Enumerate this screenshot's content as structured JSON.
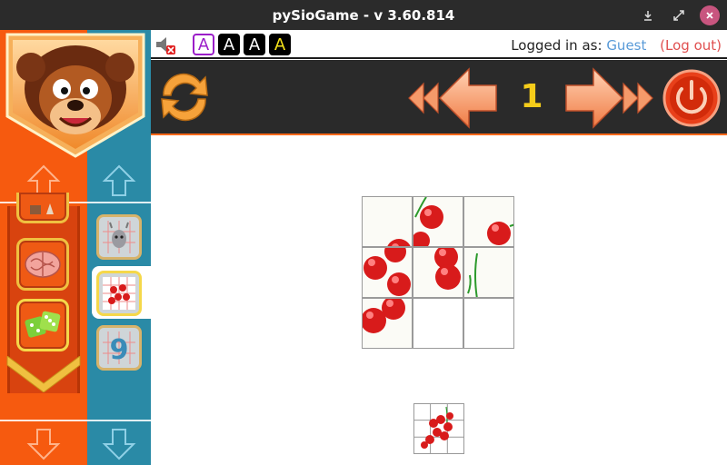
{
  "window": {
    "title": "pySioGame - v 3.60.814",
    "buttons": [
      "minimize",
      "maximize",
      "close"
    ]
  },
  "topbar": {
    "mute_icon": "speaker-muted-icon",
    "font_buttons": [
      {
        "label": "A",
        "bg": "#ffffff",
        "fg": "#9b1ec9",
        "border": "#9b1ec9"
      },
      {
        "label": "A",
        "bg": "#000000",
        "fg": "#ffffff",
        "border": "#000000"
      },
      {
        "label": "A",
        "bg": "#000000",
        "fg": "#ffffff",
        "border": "#000000"
      },
      {
        "label": "A",
        "bg": "#000000",
        "fg": "#f5e21a",
        "border": "#000000"
      }
    ],
    "login_prefix": "Logged in as:",
    "user": "Guest",
    "logout": "(Log out)"
  },
  "toolbar": {
    "level": "1",
    "icons": [
      "reload-icon",
      "fast-back-icon",
      "back-arrow-icon",
      "forward-arrow-icon",
      "fast-forward-icon",
      "power-icon"
    ]
  },
  "sidebar": {
    "categories": [
      {
        "icon": "chess-icon",
        "active": false
      },
      {
        "icon": "brain-icon",
        "active": false
      },
      {
        "icon": "dice-icon",
        "active": true
      }
    ],
    "games": [
      {
        "icon": "goat-puzzle-icon",
        "active": false
      },
      {
        "icon": "cherries-puzzle-icon",
        "active": true
      },
      {
        "icon": "number-nine-icon",
        "active": false
      }
    ]
  },
  "colors": {
    "orange": "#f65a0f",
    "teal": "#2a8aa6",
    "toolbar_bg": "#2a2a2a",
    "accent_orange": "#ff6a1a",
    "level_yellow": "#f5cc1a"
  },
  "board": {
    "rows": 3,
    "cols": 3,
    "empty_cells": [
      [
        2,
        1
      ],
      [
        2,
        2
      ]
    ]
  }
}
